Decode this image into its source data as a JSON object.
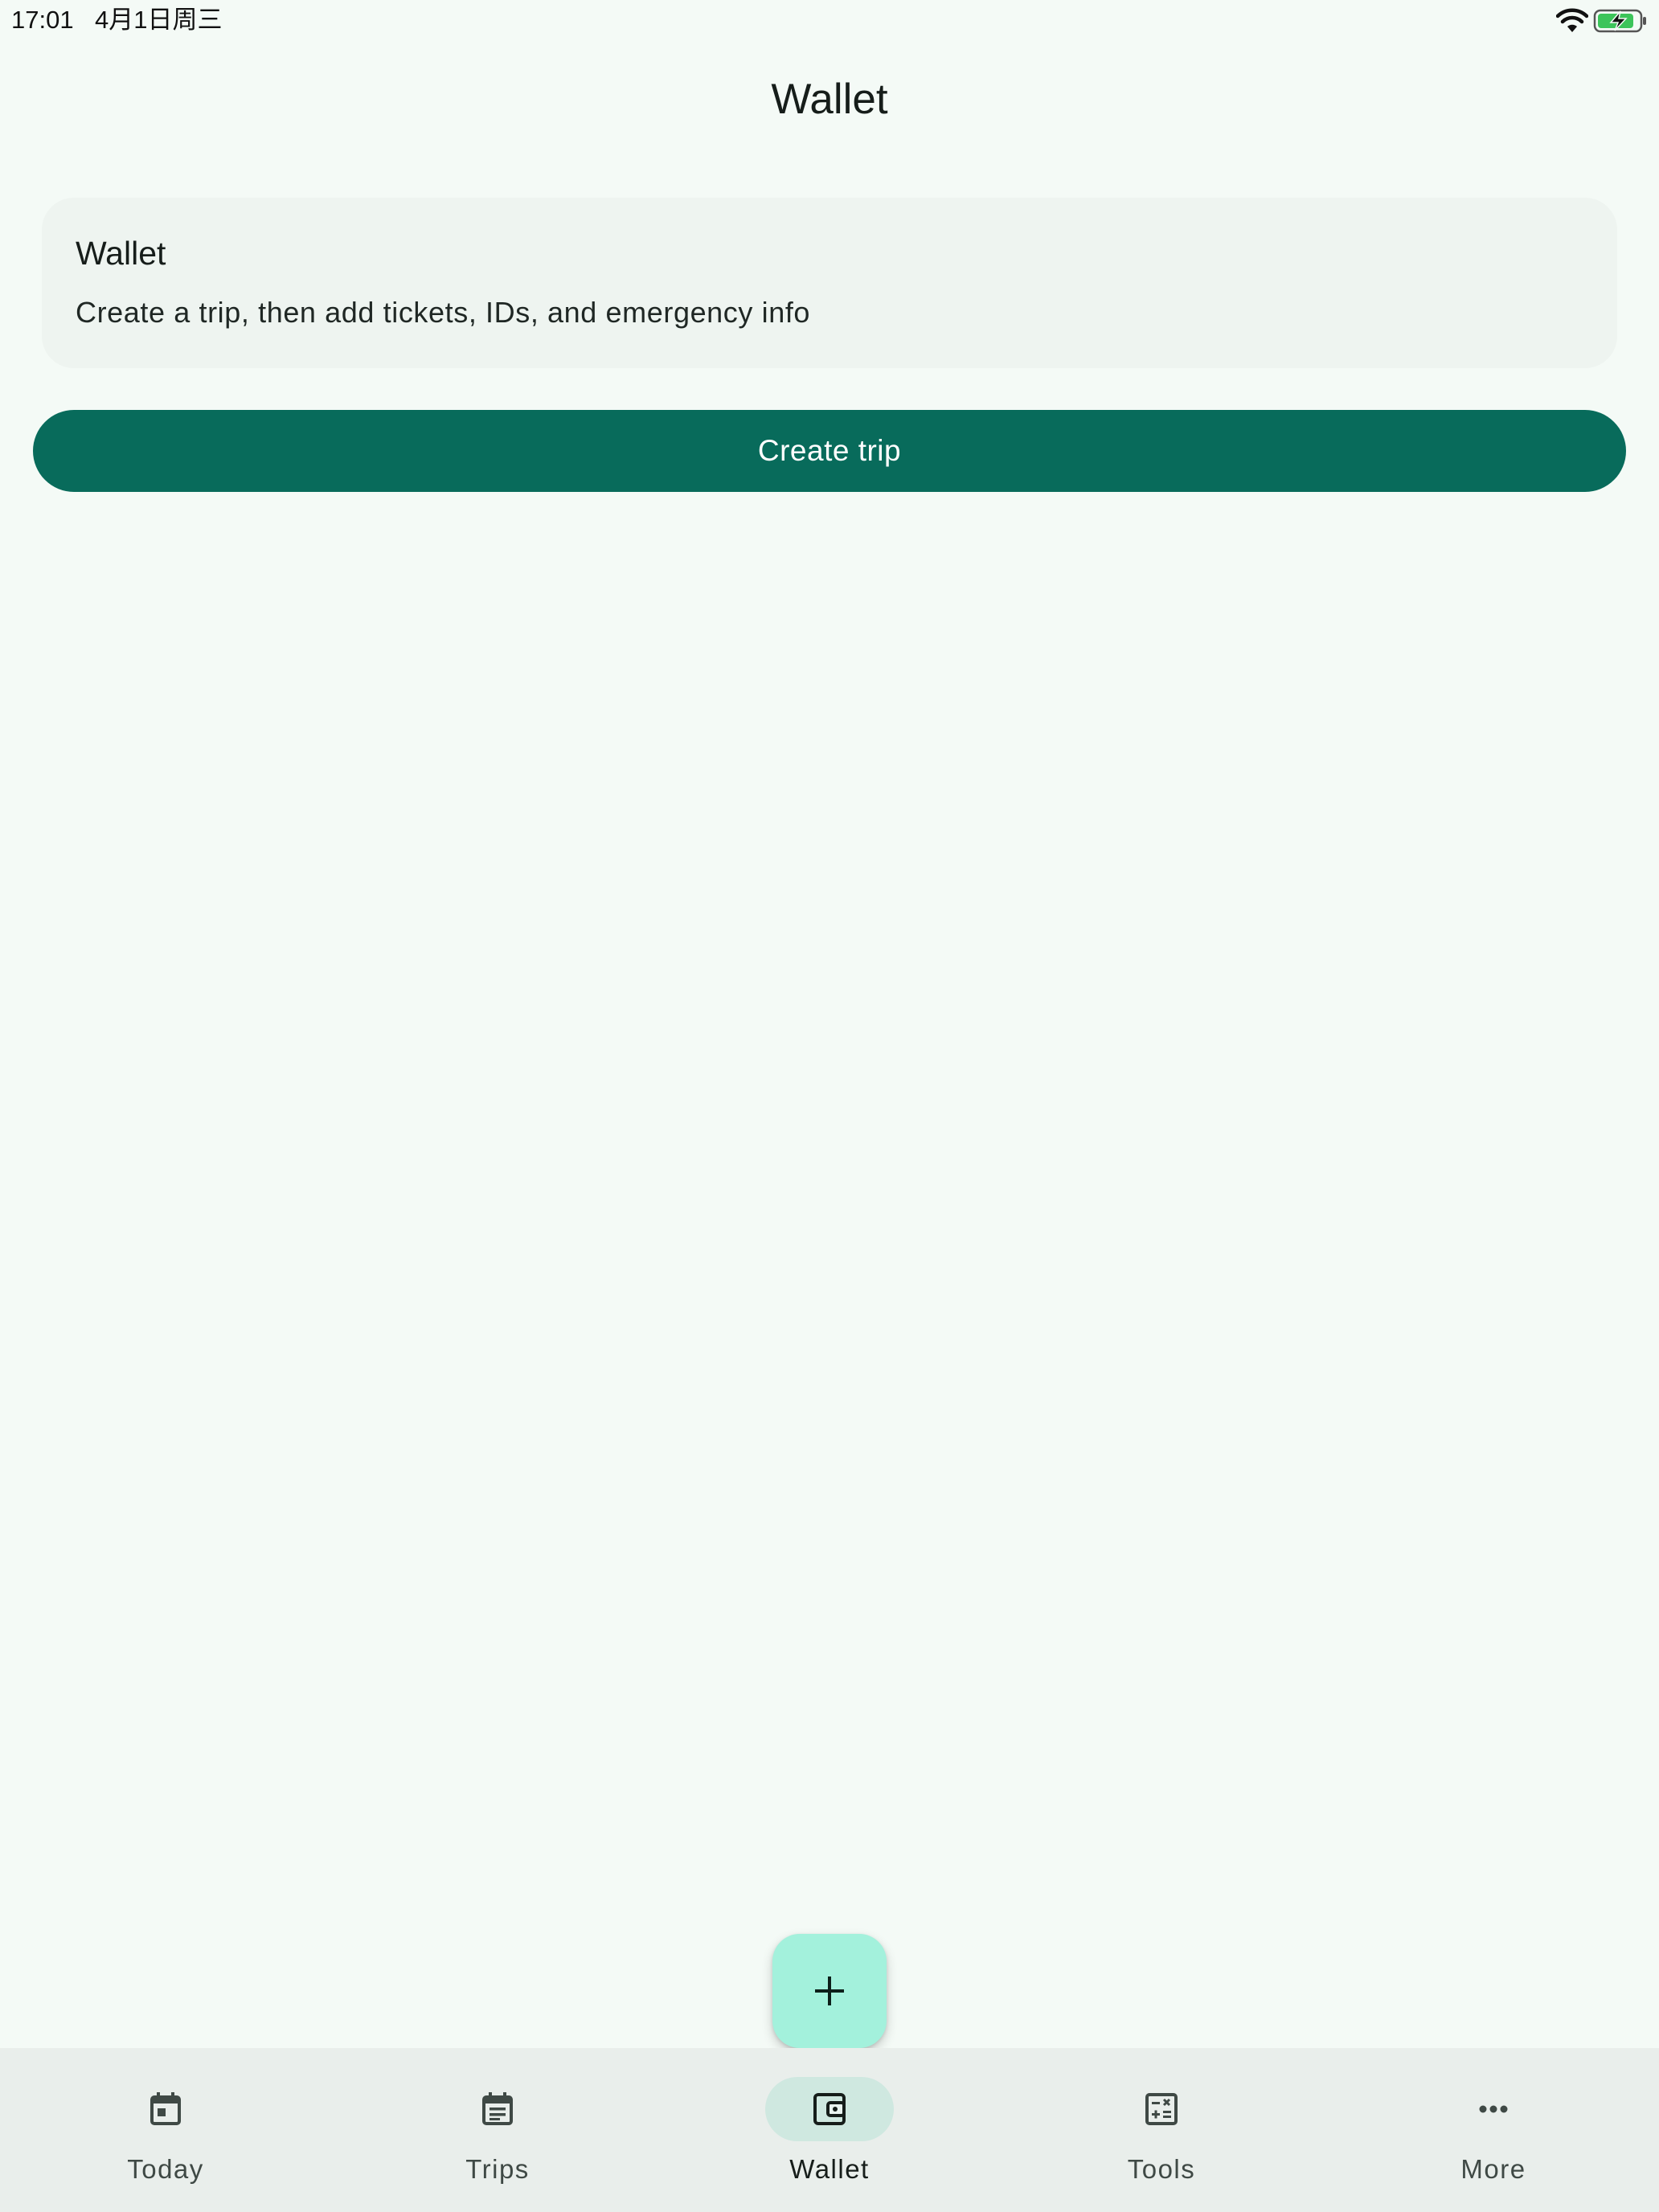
{
  "status_bar": {
    "time": "17:01",
    "date": "4月1日周三"
  },
  "header": {
    "title": "Wallet"
  },
  "info_card": {
    "title": "Wallet",
    "text": "Create a trip, then add tickets, IDs, and emergency info"
  },
  "actions": {
    "create_trip_label": "Create trip",
    "fab_icon": "plus-icon"
  },
  "bottom_nav": {
    "active": "Wallet",
    "items": [
      {
        "label": "Today",
        "icon": "calendar-today-icon"
      },
      {
        "label": "Trips",
        "icon": "event-note-icon"
      },
      {
        "label": "Wallet",
        "icon": "wallet-icon"
      },
      {
        "label": "Tools",
        "icon": "calculator-icon"
      },
      {
        "label": "More",
        "icon": "more-horizontal-icon"
      }
    ]
  },
  "colors": {
    "background": "#f4faf6",
    "primary": "#086b5b",
    "fab": "#a3f1dc",
    "nav_background": "#e9eeeb",
    "nav_active_indicator": "#cfe8e0",
    "card_background": "#eef4f0"
  }
}
